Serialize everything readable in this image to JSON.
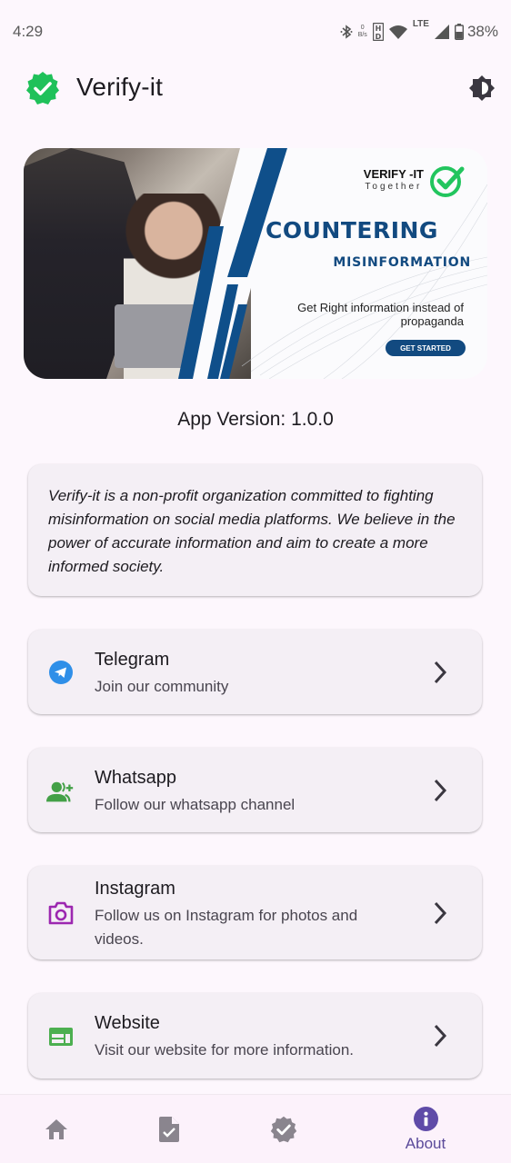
{
  "status_bar": {
    "time": "4:29",
    "net_speed_value": "0",
    "net_speed_unit": "B/s",
    "network_type": "LTE",
    "battery_percent": "38%",
    "icons": [
      "bluetooth-icon",
      "hd-icon",
      "wifi-icon",
      "signal-icon",
      "battery-icon"
    ]
  },
  "app_bar": {
    "title": "Verify-it",
    "logo_icon": "verified-badge-icon",
    "action_icon": "brightness-icon"
  },
  "banner": {
    "brand": "VERIFY -IT",
    "brand_sub": "Together",
    "headline": "COUNTERING",
    "subheadline": "MISINFORMATION",
    "tagline_line1": "Get Right information instead of",
    "tagline_line2": "propaganda",
    "cta": "GET STARTED"
  },
  "version": {
    "label": "App Version: 1.0.0"
  },
  "about": {
    "text": "Verify-it is a non-profit organization committed to fighting misinformation on social media platforms. We believe in the power of accurate information and aim to create a more informed society."
  },
  "links": [
    {
      "title": "Telegram",
      "subtitle": "Join our community",
      "icon": "telegram-icon",
      "color": "#2f8fe8"
    },
    {
      "title": "Whatsapp",
      "subtitle": "Follow our whatsapp channel",
      "icon": "group-add-icon",
      "color": "#43a047"
    },
    {
      "title": "Instagram",
      "subtitle": "Follow us on Instagram for photos and videos.",
      "icon": "camera-icon",
      "color": "#9c27b0"
    },
    {
      "title": "Website",
      "subtitle": "Visit our website for more information.",
      "icon": "web-icon",
      "color": "#4caf50"
    }
  ],
  "bottom_nav": {
    "items": [
      {
        "name": "home",
        "icon": "home-icon",
        "label": ""
      },
      {
        "name": "reports",
        "icon": "task-file-icon",
        "label": ""
      },
      {
        "name": "verify",
        "icon": "verified-icon",
        "label": ""
      },
      {
        "name": "about",
        "icon": "info-icon",
        "label": "About",
        "active": true
      }
    ],
    "active_color": "#5f4ba8",
    "inactive_color": "#8a858e"
  },
  "colors": {
    "background": "#fdf7fd",
    "card": "#f4eff5",
    "brand_green": "#1fc15a",
    "banner_blue": "#124a80"
  }
}
